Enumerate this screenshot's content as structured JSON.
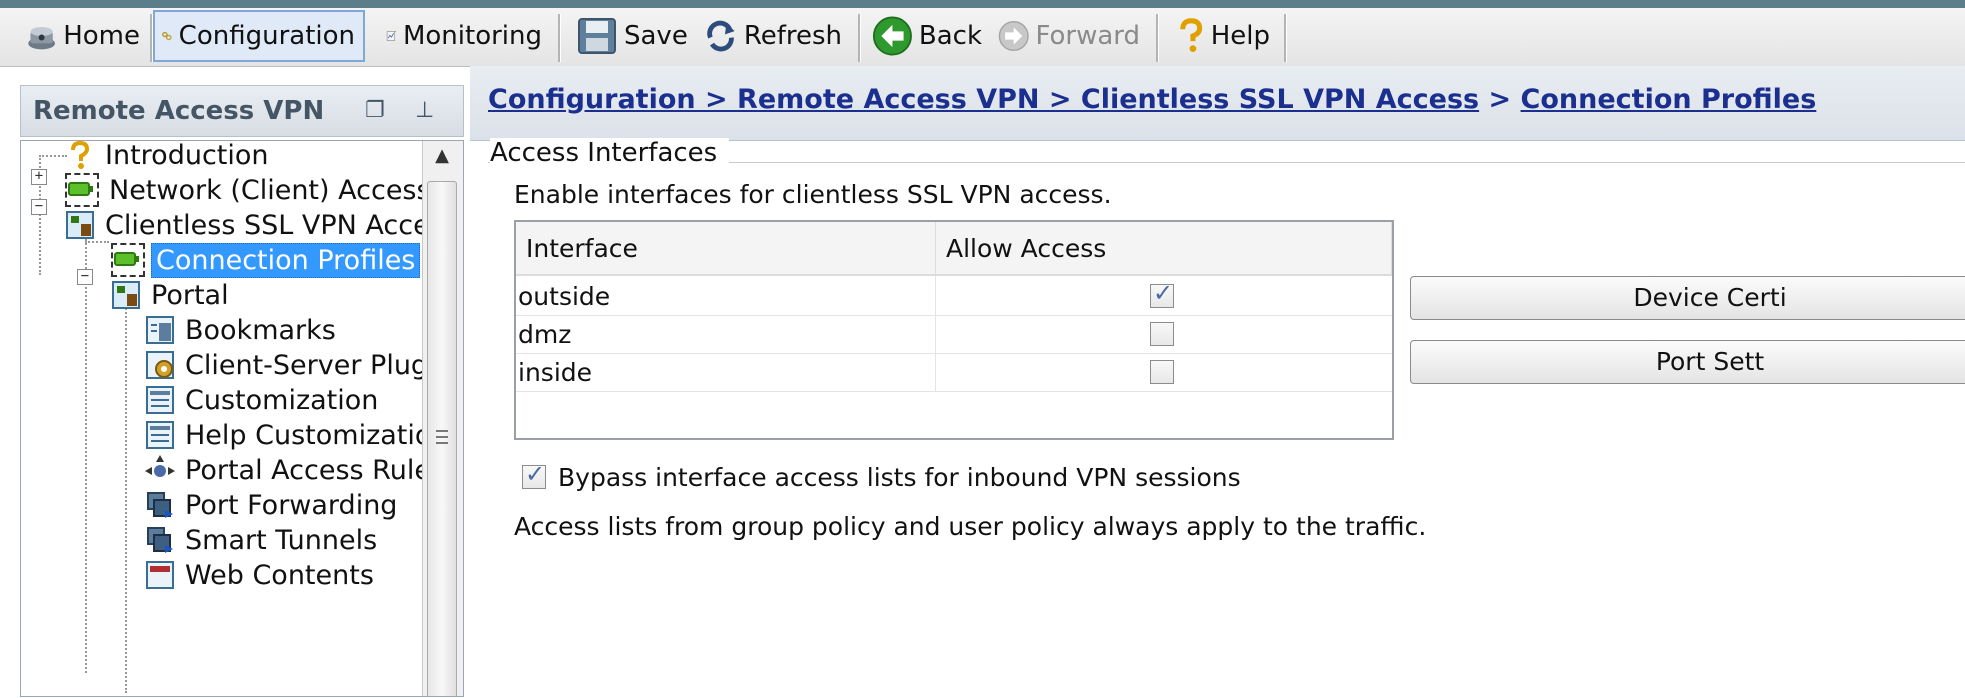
{
  "toolbar": {
    "home": "Home",
    "configuration": "Configuration",
    "monitoring": "Monitoring",
    "save": "Save",
    "refresh": "Refresh",
    "back": "Back",
    "forward": "Forward",
    "help": "Help"
  },
  "left_panel": {
    "title": "Remote Access VPN",
    "tree": [
      {
        "label": "Introduction",
        "icon": "help-icon"
      },
      {
        "label": "Network (Client) Access",
        "icon": "network-access-icon"
      },
      {
        "label": "Clientless SSL VPN Access",
        "icon": "clientless-icon"
      },
      {
        "label": "Connection Profiles",
        "icon": "connection-icon",
        "selected": true
      },
      {
        "label": "Portal",
        "icon": "portal-icon"
      },
      {
        "label": "Bookmarks",
        "icon": "bookmarks-icon"
      },
      {
        "label": "Client-Server Plug-ins",
        "icon": "plugins-icon"
      },
      {
        "label": "Customization",
        "icon": "customization-icon"
      },
      {
        "label": "Help Customization",
        "icon": "help-customization-icon"
      },
      {
        "label": "Portal Access Rules",
        "icon": "access-rules-icon"
      },
      {
        "label": "Port Forwarding",
        "icon": "port-forwarding-icon"
      },
      {
        "label": "Smart Tunnels",
        "icon": "smart-tunnels-icon"
      },
      {
        "label": "Web Contents",
        "icon": "web-contents-icon"
      }
    ]
  },
  "breadcrumb": {
    "path": "Configuration > Remote Access VPN > Clientless SSL VPN Access",
    "separator": ">",
    "current": "Connection Profiles"
  },
  "access_interfaces": {
    "title": "Access Interfaces",
    "description": "Enable interfaces for clientless SSL VPN access.",
    "columns": [
      "Interface",
      "Allow Access"
    ],
    "rows": [
      {
        "interface": "outside",
        "allow": true
      },
      {
        "interface": "dmz",
        "allow": false
      },
      {
        "interface": "inside",
        "allow": false
      }
    ],
    "buttons": {
      "device_certificate": "Device Certi",
      "port_settings": "Port Sett"
    },
    "bypass_label": "Bypass interface access lists for inbound VPN sessions",
    "bypass_checked": true,
    "note": "Access lists from group policy and user policy always apply to the traffic."
  }
}
